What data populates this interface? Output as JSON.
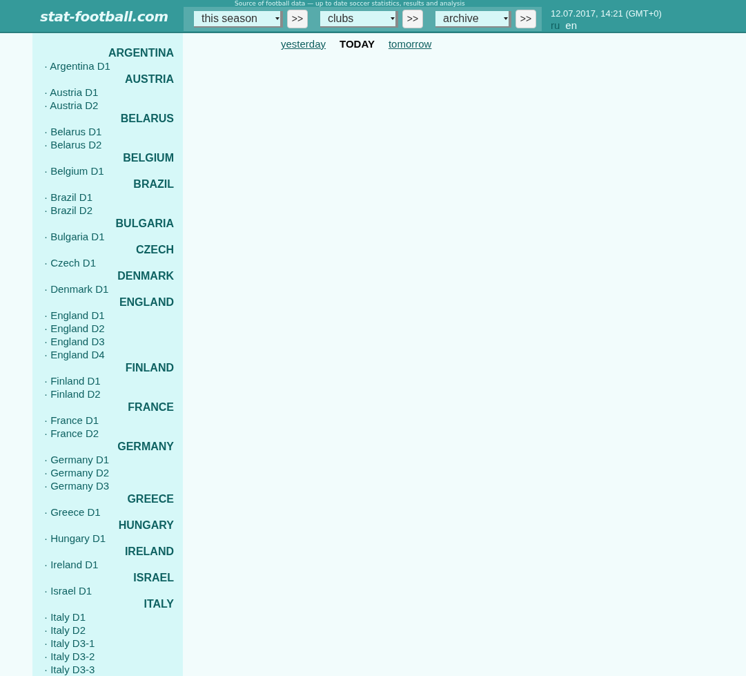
{
  "site": {
    "logo": "stat-football.com",
    "tagline": "Source of football data — up to date soccer statistics, results and analysis"
  },
  "selectors": [
    {
      "value": "this season",
      "button": ">>"
    },
    {
      "value": "clubs",
      "button": ">>"
    },
    {
      "value": "archive",
      "button": ">>"
    }
  ],
  "datetime": "12.07.2017, 14:21 (GMT+0)",
  "languages": [
    {
      "label": "ru",
      "selected": false
    },
    {
      "label": "en",
      "selected": true
    }
  ],
  "day_nav": [
    {
      "label": "yesterday",
      "selected": false
    },
    {
      "label": "TODAY",
      "selected": true
    },
    {
      "label": "tomorrow",
      "selected": false
    }
  ],
  "sidebar": [
    {
      "country": "ARGENTINA",
      "leagues": [
        "· Argentina D1"
      ]
    },
    {
      "country": "AUSTRIA",
      "leagues": [
        "· Austria D1",
        "· Austria D2"
      ]
    },
    {
      "country": "BELARUS",
      "leagues": [
        "· Belarus D1",
        "· Belarus D2"
      ]
    },
    {
      "country": "BELGIUM",
      "leagues": [
        "· Belgium D1"
      ]
    },
    {
      "country": "BRAZIL",
      "leagues": [
        "· Brazil D1",
        "· Brazil D2"
      ]
    },
    {
      "country": "BULGARIA",
      "leagues": [
        "· Bulgaria D1"
      ]
    },
    {
      "country": "CZECH",
      "leagues": [
        "· Czech D1"
      ]
    },
    {
      "country": "DENMARK",
      "leagues": [
        "· Denmark D1"
      ]
    },
    {
      "country": "ENGLAND",
      "leagues": [
        "· England D1",
        "· England D2",
        "· England D3",
        "· England D4"
      ]
    },
    {
      "country": "FINLAND",
      "leagues": [
        "· Finland D1",
        "· Finland D2"
      ]
    },
    {
      "country": "FRANCE",
      "leagues": [
        "· France D1",
        "· France D2"
      ]
    },
    {
      "country": "GERMANY",
      "leagues": [
        "· Germany D1",
        "· Germany D2",
        "· Germany D3"
      ]
    },
    {
      "country": "GREECE",
      "leagues": [
        "· Greece D1"
      ]
    },
    {
      "country": "HUNGARY",
      "leagues": [
        "· Hungary D1"
      ]
    },
    {
      "country": "IRELAND",
      "leagues": [
        "· Ireland D1"
      ]
    },
    {
      "country": "ISRAEL",
      "leagues": [
        "· Israel D1"
      ]
    },
    {
      "country": "ITALY",
      "leagues": [
        "· Italy D1",
        "· Italy D2",
        "· Italy D3-1",
        "· Italy D3-2",
        "· Italy D3-3"
      ]
    }
  ]
}
